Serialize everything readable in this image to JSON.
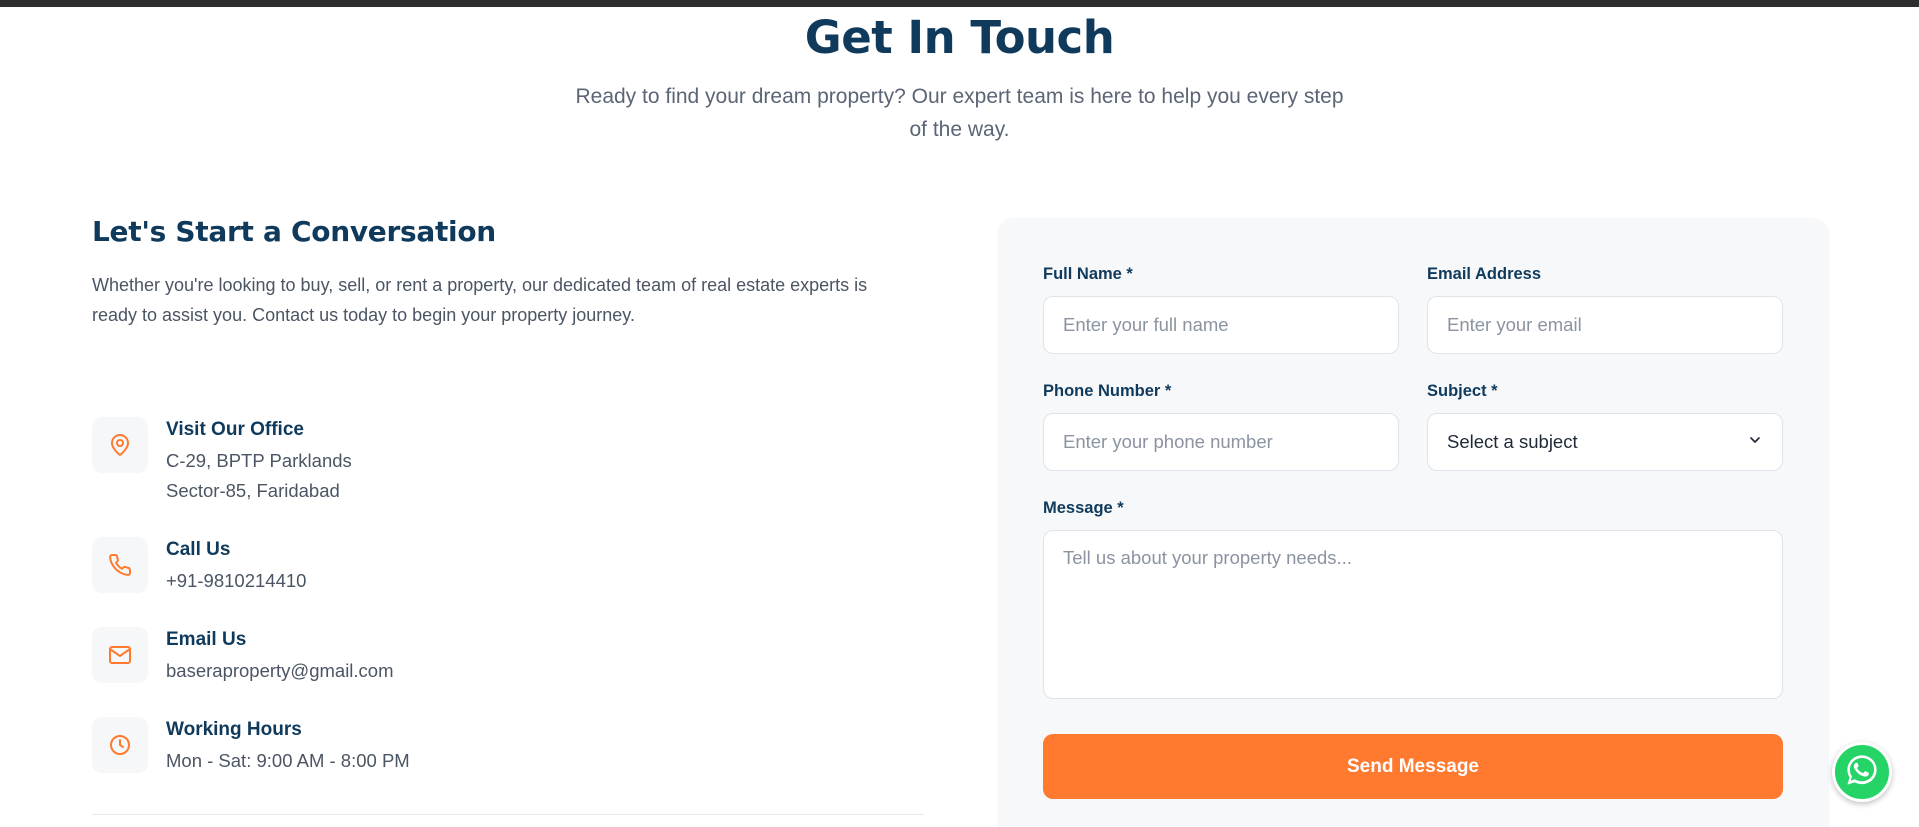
{
  "hero": {
    "title": "Get In Touch",
    "subtitle": "Ready to find your dream property? Our expert team is here to help you every step of the way."
  },
  "contact": {
    "heading": "Let's Start a Conversation",
    "intro": "Whether you're looking to buy, sell, or rent a property, our dedicated team of real estate experts is ready to assist you. Contact us today to begin your property journey.",
    "items": [
      {
        "icon": "map-pin-icon",
        "title": "Visit Our Office",
        "lines": [
          "C-29, BPTP Parklands",
          "Sector-85, Faridabad"
        ]
      },
      {
        "icon": "phone-icon",
        "title": "Call Us",
        "lines": [
          "+91-9810214410"
        ]
      },
      {
        "icon": "mail-icon",
        "title": "Email Us",
        "lines": [
          "baseraproperty@gmail.com"
        ]
      },
      {
        "icon": "clock-icon",
        "title": "Working Hours",
        "lines": [
          "Mon - Sat: 9:00 AM - 8:00 PM"
        ]
      }
    ]
  },
  "form": {
    "full_name": {
      "label": "Full Name *",
      "placeholder": "Enter your full name"
    },
    "email": {
      "label": "Email Address",
      "placeholder": "Enter your email"
    },
    "phone": {
      "label": "Phone Number *",
      "placeholder": "Enter your phone number"
    },
    "subject": {
      "label": "Subject *",
      "value": "Select a subject"
    },
    "message": {
      "label": "Message *",
      "placeholder": "Tell us about your property needs..."
    },
    "submit_label": "Send Message"
  },
  "colors": {
    "accent": "#ff7a2e",
    "heading": "#0f3a5c",
    "whatsapp": "#25d366"
  }
}
